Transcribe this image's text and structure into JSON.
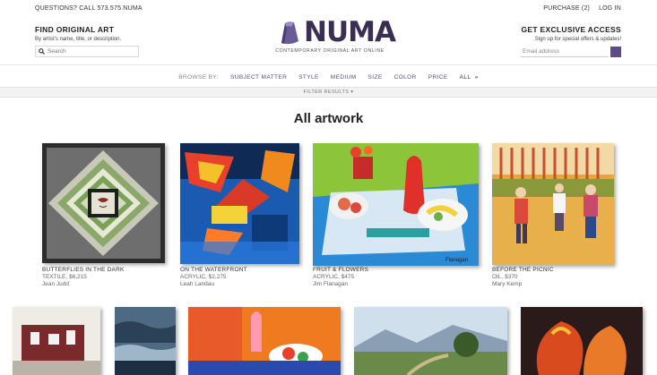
{
  "topbar": {
    "contact": "QUESTIONS? CALL 573.575.NUMA",
    "purchase": "PURCHASE (2)",
    "login": "LOG IN"
  },
  "find": {
    "heading": "FIND ORIGINAL ART",
    "subtitle": "By artist's name, title, or description.",
    "search_placeholder": "Search"
  },
  "brand": {
    "name": "NUMA",
    "tagline": "CONTEMPORARY ORIGINAL ART ONLINE"
  },
  "exclusive": {
    "heading": "GET EXCLUSIVE ACCESS",
    "subtitle": "Sign up for special offers & updates!",
    "email_placeholder": "Email address"
  },
  "browse": {
    "label": "BROWSE BY:",
    "items": [
      "SUBJECT MATTER",
      "STYLE",
      "MEDIUM",
      "SIZE",
      "COLOR",
      "PRICE"
    ],
    "all": "ALL",
    "arrow": "»"
  },
  "filter_label": "FILTER RESULTS ▾",
  "page_title": "All artwork",
  "artworks": [
    {
      "title": "BUTTERFLIES IN THE DARK",
      "meta": "TEXTILE, $6,215",
      "artist": "Jean Judd"
    },
    {
      "title": "ON THE WATERFRONT",
      "meta": "ACRYLIC, $2,275",
      "artist": "Leah Landau"
    },
    {
      "title": "FRUIT & FLOWERS",
      "meta": "ACRYLIC, $475",
      "artist": "Jim Flanagan"
    },
    {
      "title": "BEFORE THE PICNIC",
      "meta": "OIL, $370",
      "artist": "Mary Kemp"
    }
  ],
  "colors": {
    "accent": "#5a4a8a",
    "brand_dark": "#3a2f52"
  }
}
